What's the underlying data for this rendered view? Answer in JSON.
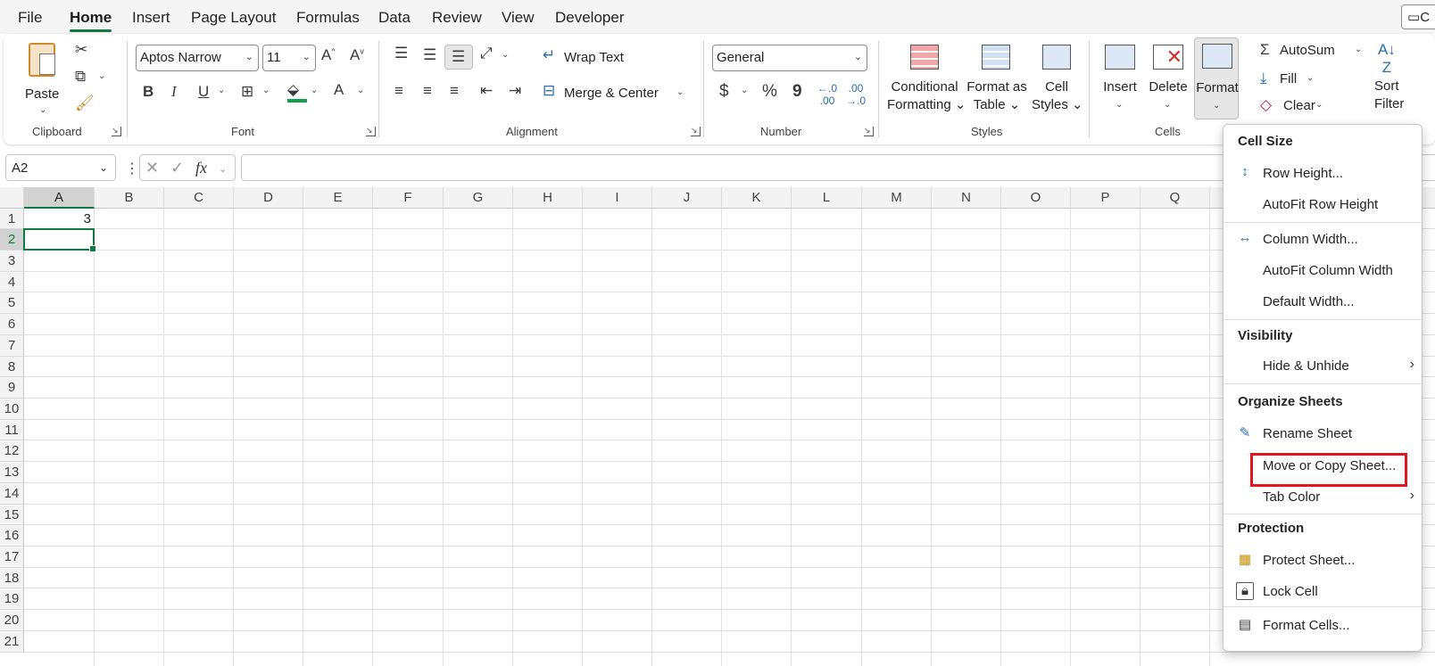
{
  "menu_tabs": [
    "File",
    "Home",
    "Insert",
    "Page Layout",
    "Formulas",
    "Data",
    "Review",
    "View",
    "Developer"
  ],
  "active_tab": "Home",
  "comments_button": "C",
  "ribbon": {
    "clipboard": {
      "paste": "Paste",
      "label": "Clipboard"
    },
    "font": {
      "name": "Aptos Narrow",
      "size": "11",
      "label": "Font",
      "bold": "B",
      "italic": "I",
      "underline": "U",
      "font_color_glyph": "A"
    },
    "alignment": {
      "wrap_text": "Wrap Text",
      "merge_center": "Merge & Center",
      "label": "Alignment"
    },
    "number": {
      "format": "General",
      "label": "Number",
      "currency": "$",
      "percent": "%",
      "comma": "9"
    },
    "styles": {
      "conditional_formatting": [
        "Conditional",
        "Formatting"
      ],
      "format_as_table": [
        "Format as",
        "Table"
      ],
      "cell_styles": [
        "Cell",
        "Styles"
      ],
      "label": "Styles"
    },
    "cells": {
      "insert": "Insert",
      "delete": "Delete",
      "format": "Format",
      "label": "Cells"
    },
    "editing": {
      "autosum": "AutoSum",
      "fill": "Fill",
      "clear": "Clear",
      "sort": [
        "Sort",
        "Filter"
      ]
    }
  },
  "formula_bar": {
    "name_box": "A2",
    "fx": "fx",
    "value": ""
  },
  "grid": {
    "columns": [
      "A",
      "B",
      "C",
      "D",
      "E",
      "F",
      "G",
      "H",
      "I",
      "J",
      "K",
      "L",
      "M",
      "N",
      "O",
      "P",
      "Q"
    ],
    "rows": [
      "1",
      "2",
      "3",
      "4",
      "5",
      "6",
      "7",
      "8",
      "9",
      "10",
      "11",
      "12",
      "13",
      "14",
      "15",
      "16",
      "17",
      "18",
      "19",
      "20",
      "21"
    ],
    "cells": {
      "A1": "3"
    },
    "active_cell": "A2"
  },
  "format_menu": {
    "cell_size_header": "Cell Size",
    "row_height": "Row Height...",
    "autofit_row_height": "AutoFit Row Height",
    "column_width": "Column Width...",
    "autofit_column_width": "AutoFit Column Width",
    "default_width": "Default Width...",
    "visibility_header": "Visibility",
    "hide_unhide": "Hide & Unhide",
    "organize_header": "Organize Sheets",
    "rename_sheet": "Rename Sheet",
    "move_copy_sheet": "Move or Copy Sheet...",
    "tab_color": "Tab Color",
    "protection_header": "Protection",
    "protect_sheet": "Protect Sheet...",
    "lock_cell": "Lock Cell",
    "format_cells": "Format Cells...",
    "highlight_color": "#e0151d"
  },
  "colors": {
    "accent": "#117a3e",
    "highlight": "#e0151d"
  }
}
